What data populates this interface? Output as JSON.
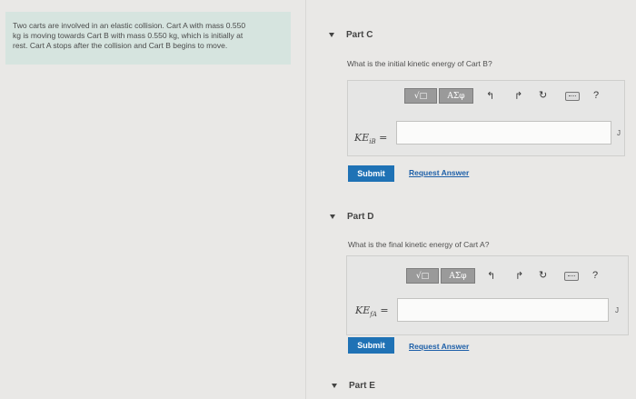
{
  "problem": {
    "lines": [
      "Two carts are involved in an elastic collision. Cart A with mass 0.550",
      "kg is moving towards Cart B with mass 0.550 kg, which is initially at",
      "rest. Cart A stops after the collision and Cart B begins to move."
    ]
  },
  "toolbar": {
    "sqrt_label": "√□",
    "greek_label": "ΑΣφ",
    "help_label": "?"
  },
  "part_c": {
    "title": "Part C",
    "question": "What is the initial kinetic energy of Cart B?",
    "label_main": "KE",
    "label_sub": "iB",
    "label_eq": " =",
    "input_value": "",
    "units": "J",
    "submit_label": "Submit",
    "request_label": "Request Answer"
  },
  "part_d": {
    "title": "Part D",
    "question": "What is the final kinetic energy of Cart A?",
    "label_main": "KE",
    "label_sub": "fA",
    "label_eq": " =",
    "input_value": "",
    "units": "J",
    "submit_label": "Submit",
    "request_label": "Request Answer"
  },
  "part_e": {
    "title": "Part E"
  }
}
